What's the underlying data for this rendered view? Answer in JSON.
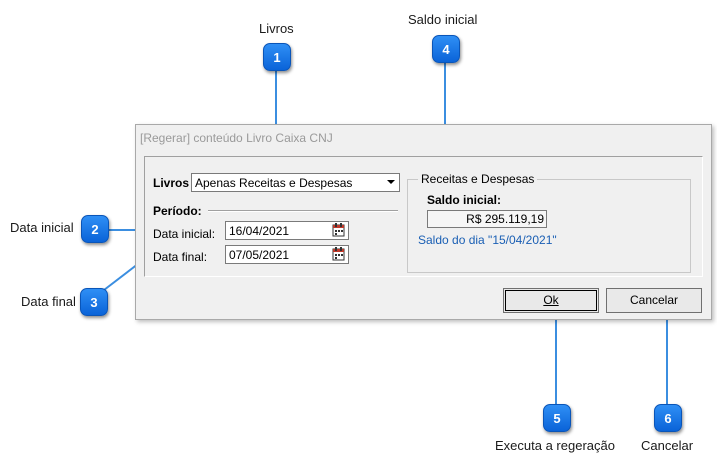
{
  "callouts": {
    "c1": {
      "number": "1",
      "title": "Livros"
    },
    "c2": {
      "number": "2",
      "title": "Data inicial"
    },
    "c3": {
      "number": "3",
      "title": "Data final"
    },
    "c4": {
      "number": "4",
      "title": "Saldo inicial"
    },
    "c5": {
      "number": "5",
      "title": "Executa a regeração"
    },
    "c6": {
      "number": "6",
      "title": "Cancelar"
    }
  },
  "dialog": {
    "title": "[Regerar] conteúdo Livro Caixa CNJ",
    "livros_label": "Livros",
    "livros_value": "Apenas Receitas e Despesas",
    "periodo_label": "Período:",
    "data_inicial_label": "Data inicial:",
    "data_inicial_value": "16/04/2021",
    "data_final_label": "Data final:",
    "data_final_value": "07/05/2021",
    "group_title": "Receitas e Despesas",
    "saldo_label": "Saldo inicial:",
    "saldo_value": "R$ 295.119,19",
    "saldo_note": "Saldo do dia \"15/04/2021\"",
    "ok_label": "Ok",
    "cancel_label": "Cancelar"
  },
  "icons": {
    "date_picker": "calendar-icon",
    "combo_arrow": "chevron-down-icon"
  },
  "colors": {
    "badge": "#1a7ae8",
    "connector": "#3b8ee0",
    "note": "#1a5fb4"
  }
}
